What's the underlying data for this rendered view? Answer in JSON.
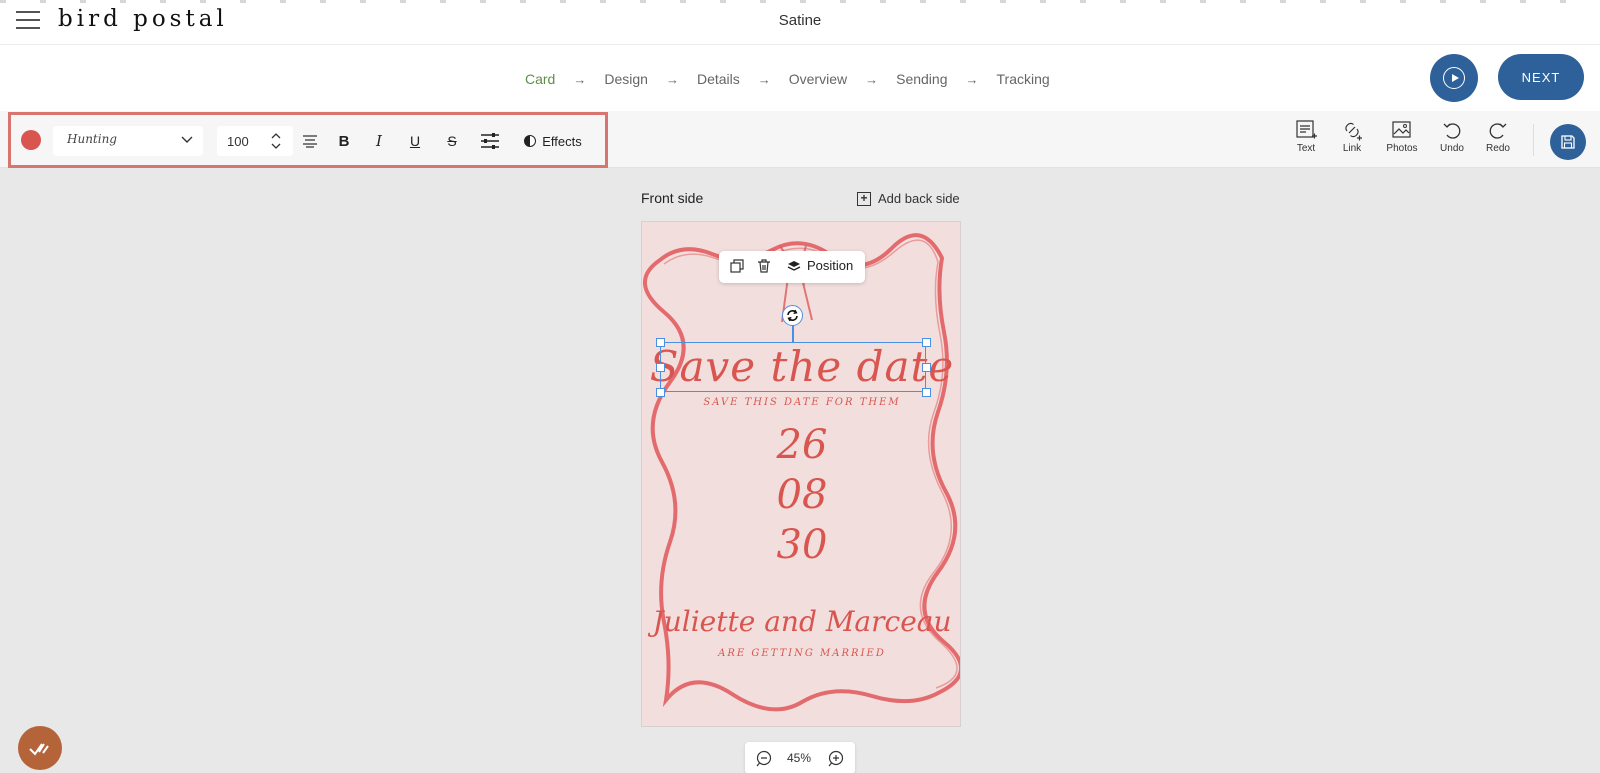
{
  "header": {
    "logo": "bird postal",
    "doc_title": "Satine"
  },
  "steps": [
    {
      "label": "Card",
      "active": true
    },
    {
      "label": "Design",
      "active": false
    },
    {
      "label": "Details",
      "active": false
    },
    {
      "label": "Overview",
      "active": false
    },
    {
      "label": "Sending",
      "active": false
    },
    {
      "label": "Tracking",
      "active": false
    }
  ],
  "actions": {
    "next_label": "NEXT"
  },
  "toolbar": {
    "text_color": "#d9554f",
    "font_name": "Hunting",
    "font_size": "100",
    "bold": "B",
    "italic": "I",
    "underline": "U",
    "strike": "S",
    "effects_label": "Effects"
  },
  "right_tools": {
    "text": "Text",
    "link": "Link",
    "photos": "Photos",
    "undo": "Undo",
    "redo": "Redo"
  },
  "canvas": {
    "front_label": "Front side",
    "add_back_label": "Add back side",
    "zoom": "45%",
    "position_label": "Position"
  },
  "card": {
    "title": "Save the date",
    "subtitle": "SAVE THIS DATE FOR THEM",
    "day": "26",
    "month": "08",
    "year": "30",
    "names": "Juliette and Marceau",
    "tagline": "ARE GETTING MARRIED"
  },
  "colors": {
    "brand": "#2e6199",
    "accent_red": "#d9554f",
    "step_active": "#5e8f4a",
    "highlight_border": "#d9756f",
    "helper": "#b5643a"
  }
}
